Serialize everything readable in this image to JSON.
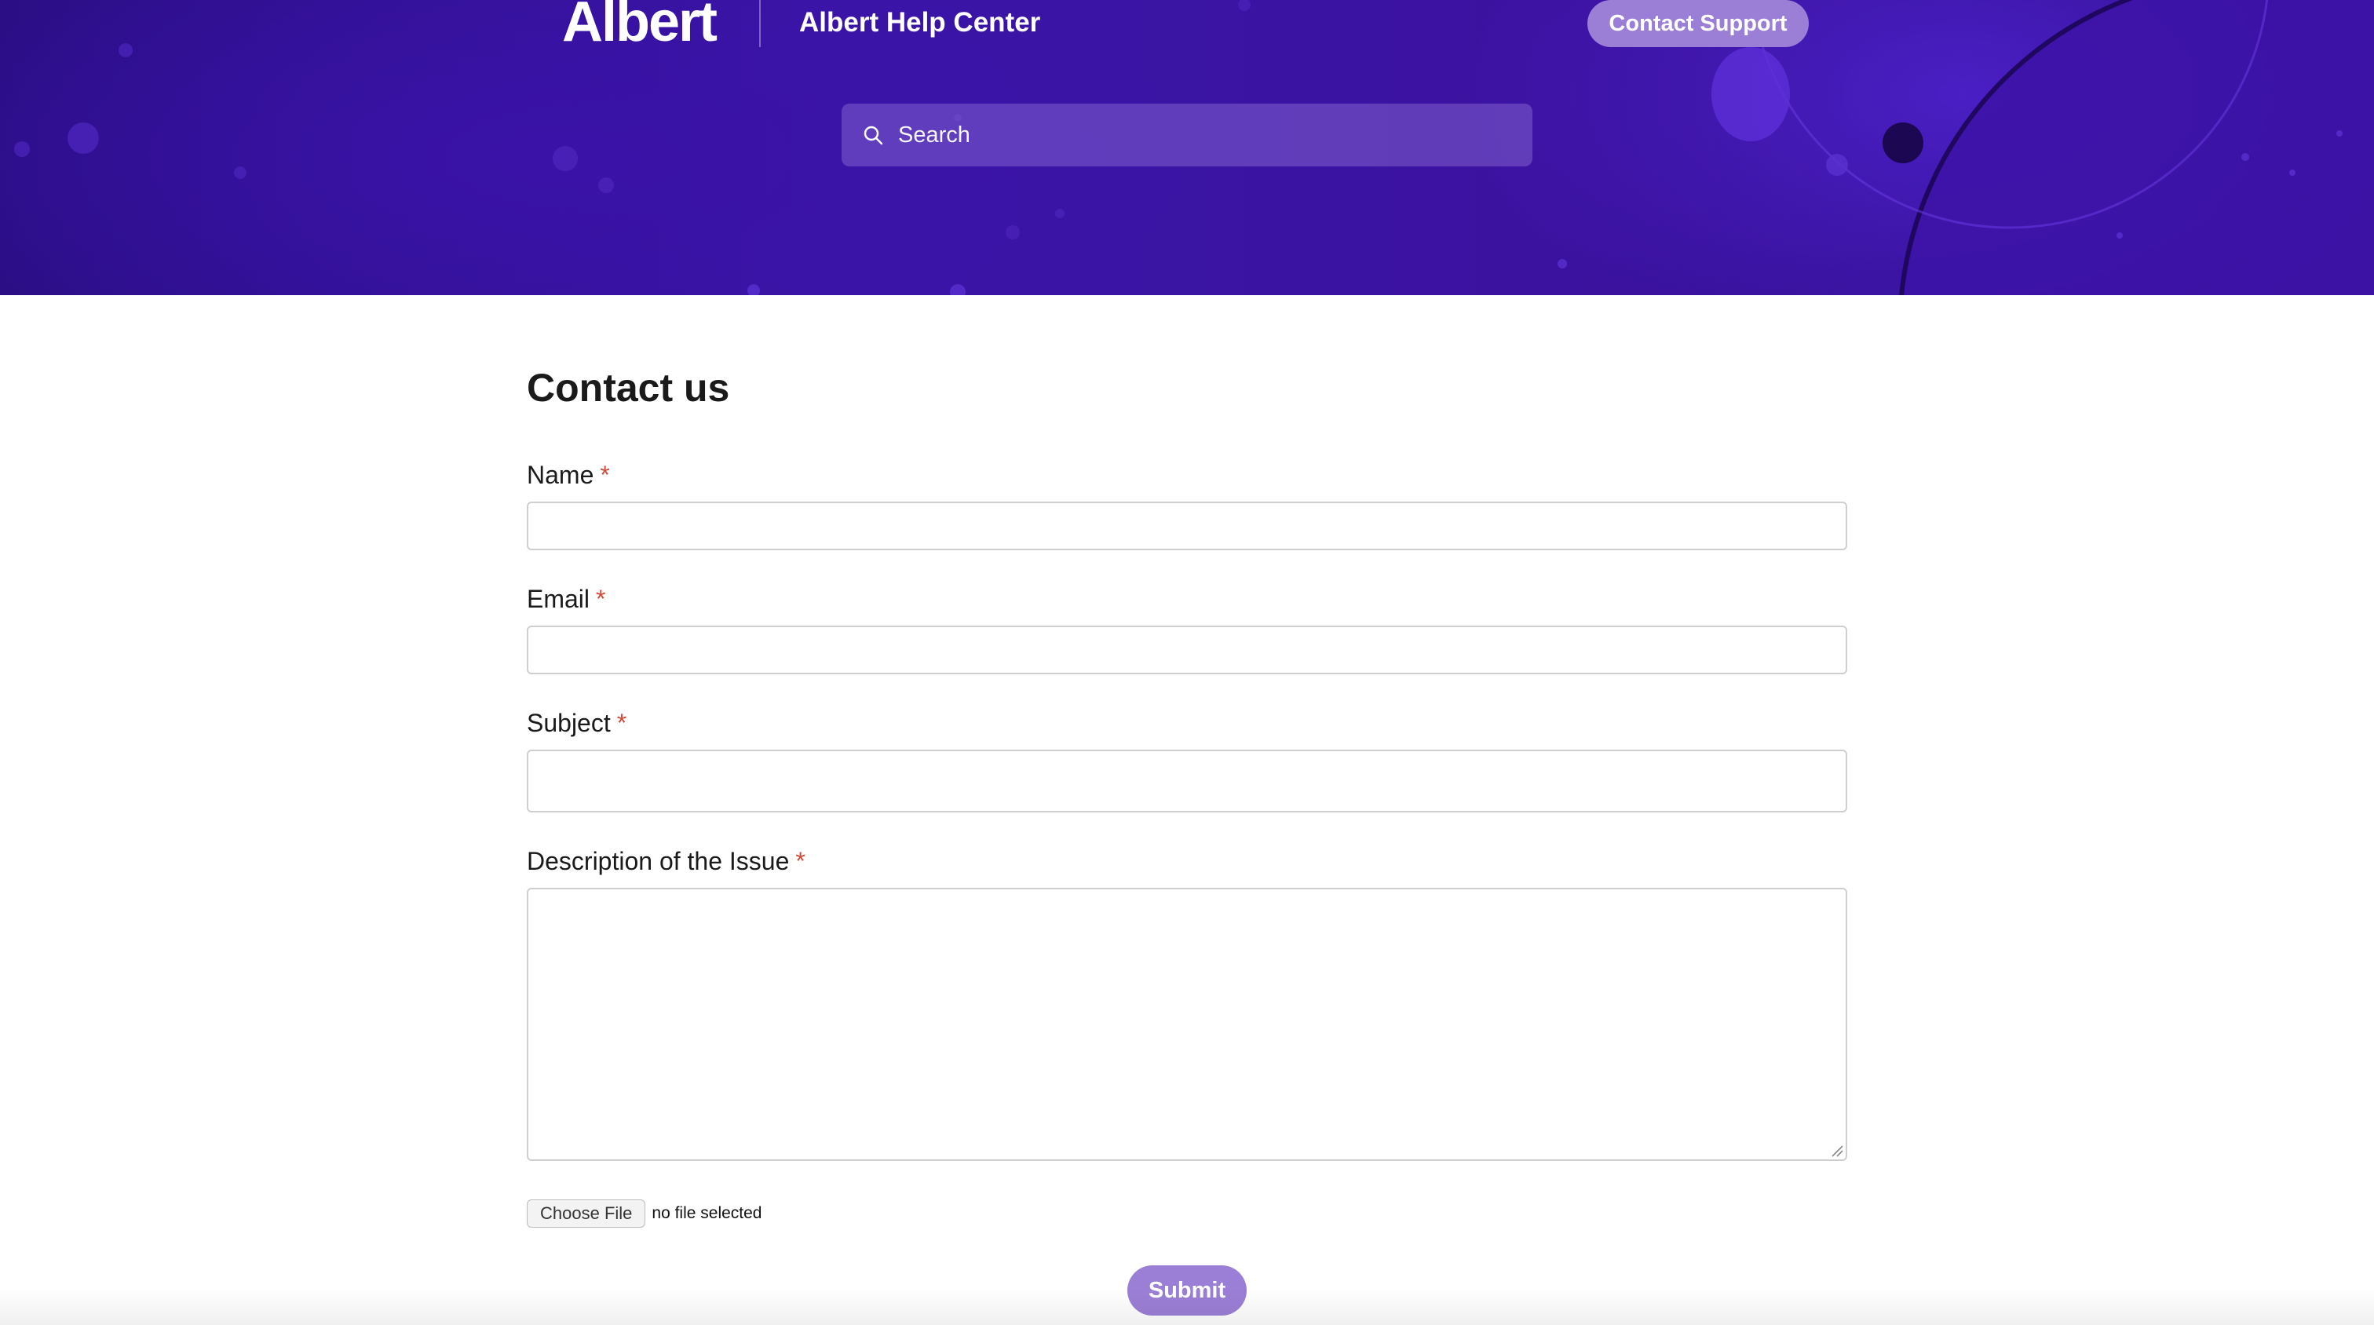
{
  "header": {
    "logo_text": "Albert",
    "title": "Albert Help Center",
    "contact_support_label": "Contact Support",
    "search_placeholder": "Search",
    "search_value": ""
  },
  "form": {
    "title": "Contact us",
    "required_marker": "*",
    "fields": [
      {
        "label": "Name",
        "value": "",
        "required": true
      },
      {
        "label": "Email",
        "value": "",
        "required": true
      },
      {
        "label": "Subject",
        "value": "",
        "required": true
      },
      {
        "label": "Description of the Issue",
        "value": "",
        "required": true
      }
    ],
    "choose_file_label": "Choose File",
    "file_status": "no file selected",
    "submit_label": "Submit"
  },
  "colors": {
    "hero_purple": "#3a15a6",
    "button_purple": "#9b7fd6",
    "required_red": "#d04a3a"
  },
  "icons": {
    "search": "search-icon",
    "resize": "resize-grip-icon"
  }
}
